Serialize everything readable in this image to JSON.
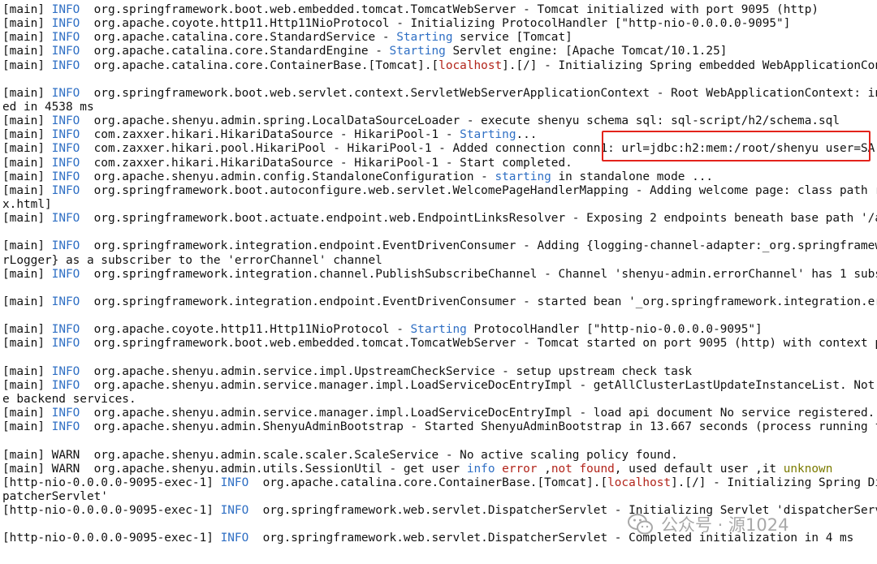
{
  "colors": {
    "default": "#111111",
    "info": "#2f6fc4",
    "blue": "#2f6fc4",
    "red": "#b2241a",
    "olive": "#7b7b00",
    "highlight_border": "#e3231b"
  },
  "watermark": {
    "icon": "wechat-icon",
    "text": "公众号 · 源1024"
  },
  "lines": [
    [
      [
        "[main] ",
        ""
      ],
      [
        "INFO",
        "info"
      ],
      [
        "  org.springframework.boot.web.embedded.tomcat.TomcatWebServer - Tomcat initialized with port 9095 (http)",
        ""
      ]
    ],
    [
      [
        "[main] ",
        ""
      ],
      [
        "INFO",
        "info"
      ],
      [
        "  org.apache.coyote.http11.Http11NioProtocol - Initializing ProtocolHandler [\"http-nio-0.0.0.0-9095\"]",
        ""
      ]
    ],
    [
      [
        "[main] ",
        ""
      ],
      [
        "INFO",
        "info"
      ],
      [
        "  org.apache.catalina.core.StandardService - ",
        ""
      ],
      [
        "Starting",
        "blue"
      ],
      [
        " service [Tomcat]",
        ""
      ]
    ],
    [
      [
        "[main] ",
        ""
      ],
      [
        "INFO",
        "info"
      ],
      [
        "  org.apache.catalina.core.StandardEngine - ",
        ""
      ],
      [
        "Starting",
        "blue"
      ],
      [
        " Servlet engine: [Apache Tomcat/10.1.25]",
        ""
      ]
    ],
    [
      [
        "[main] ",
        ""
      ],
      [
        "INFO",
        "info"
      ],
      [
        "  org.apache.catalina.core.ContainerBase.[Tomcat].[",
        ""
      ],
      [
        "localhost",
        "red"
      ],
      [
        "].[/] - Initializing Spring embedded WebApplicationCon",
        ""
      ]
    ],
    [],
    [
      [
        "[main] ",
        ""
      ],
      [
        "INFO",
        "info"
      ],
      [
        "  org.springframework.boot.web.servlet.context.ServletWebServerApplicationContext - Root WebApplicationContext: in",
        ""
      ]
    ],
    [
      [
        "ed in 4538 ms",
        ""
      ]
    ],
    [
      [
        "[main] ",
        ""
      ],
      [
        "INFO",
        "info"
      ],
      [
        "  org.apache.shenyu.admin.spring.LocalDataSourceLoader - execute shenyu schema sql: sql-script/h2/schema.sql",
        ""
      ]
    ],
    [
      [
        "[main] ",
        ""
      ],
      [
        "INFO",
        "info"
      ],
      [
        "  com.zaxxer.hikari.HikariDataSource - HikariPool-1 - ",
        ""
      ],
      [
        "Starting",
        "blue"
      ],
      [
        "...",
        ""
      ]
    ],
    [
      [
        "[main] ",
        ""
      ],
      [
        "INFO",
        "info"
      ],
      [
        "  com.zaxxer.hikari.pool.HikariPool - HikariPool-1 - Added connection conn1: url=jdbc:h2:mem:/root/shenyu user=SA",
        ""
      ]
    ],
    [
      [
        "[main] ",
        ""
      ],
      [
        "INFO",
        "info"
      ],
      [
        "  com.zaxxer.hikari.HikariDataSource - HikariPool-1 - Start completed.",
        ""
      ]
    ],
    [
      [
        "[main] ",
        ""
      ],
      [
        "INFO",
        "info"
      ],
      [
        "  org.apache.shenyu.admin.config.StandaloneConfiguration - ",
        ""
      ],
      [
        "starting",
        "blue"
      ],
      [
        " in standalone mode ...",
        ""
      ]
    ],
    [
      [
        "[main] ",
        ""
      ],
      [
        "INFO",
        "info"
      ],
      [
        "  org.springframework.boot.autoconfigure.web.servlet.WelcomePageHandlerMapping - Adding welcome page: class path r",
        ""
      ]
    ],
    [
      [
        "x.html]",
        ""
      ]
    ],
    [
      [
        "[main] ",
        ""
      ],
      [
        "INFO",
        "info"
      ],
      [
        "  org.springframework.boot.actuate.endpoint.web.EndpointLinksResolver - Exposing 2 endpoints beneath base path '/a",
        ""
      ]
    ],
    [],
    [
      [
        "[main] ",
        ""
      ],
      [
        "INFO",
        "info"
      ],
      [
        "  org.springframework.integration.endpoint.EventDrivenConsumer - Adding {logging-channel-adapter:_org.springframew",
        ""
      ]
    ],
    [
      [
        "rLogger} as a subscriber to the 'errorChannel' channel",
        ""
      ]
    ],
    [
      [
        "[main] ",
        ""
      ],
      [
        "INFO",
        "info"
      ],
      [
        "  org.springframework.integration.channel.PublishSubscribeChannel - Channel 'shenyu-admin.errorChannel' has 1 subs",
        ""
      ]
    ],
    [],
    [
      [
        "[main] ",
        ""
      ],
      [
        "INFO",
        "info"
      ],
      [
        "  org.springframework.integration.endpoint.EventDrivenConsumer - started bean '_org.springframework.integration.er",
        ""
      ]
    ],
    [],
    [
      [
        "[main] ",
        ""
      ],
      [
        "INFO",
        "info"
      ],
      [
        "  org.apache.coyote.http11.Http11NioProtocol - ",
        ""
      ],
      [
        "Starting",
        "blue"
      ],
      [
        " ProtocolHandler [\"http-nio-0.0.0.0-9095\"]",
        ""
      ]
    ],
    [
      [
        "[main] ",
        ""
      ],
      [
        "INFO",
        "info"
      ],
      [
        "  org.springframework.boot.web.embedded.tomcat.TomcatWebServer - Tomcat started on port 9095 (http) with context p",
        ""
      ]
    ],
    [],
    [
      [
        "[main] ",
        ""
      ],
      [
        "INFO",
        "info"
      ],
      [
        "  org.apache.shenyu.admin.service.impl.UpstreamCheckService - setup upstream check task",
        ""
      ]
    ],
    [
      [
        "[main] ",
        ""
      ],
      [
        "INFO",
        "info"
      ],
      [
        "  org.apache.shenyu.admin.service.manager.impl.LoadServiceDocEntryImpl - getAllClusterLastUpdateInstanceList. Not",
        ""
      ]
    ],
    [
      [
        "e backend services.",
        ""
      ]
    ],
    [
      [
        "[main] ",
        ""
      ],
      [
        "INFO",
        "info"
      ],
      [
        "  org.apache.shenyu.admin.service.manager.impl.LoadServiceDocEntryImpl - load api document No service registered.",
        ""
      ]
    ],
    [
      [
        "[main] ",
        ""
      ],
      [
        "INFO",
        "info"
      ],
      [
        "  org.apache.shenyu.admin.ShenyuAdminBootstrap - Started ShenyuAdminBootstrap in 13.667 seconds (process running f",
        ""
      ]
    ],
    [],
    [
      [
        "[main] ",
        ""
      ],
      [
        "WARN",
        "warn"
      ],
      [
        "  org.apache.shenyu.admin.scale.scaler.ScaleService - No active scaling policy found.",
        ""
      ]
    ],
    [
      [
        "[main] ",
        ""
      ],
      [
        "WARN",
        "warn"
      ],
      [
        "  org.apache.shenyu.admin.utils.SessionUtil - get user ",
        ""
      ],
      [
        "info",
        "blue"
      ],
      [
        " ",
        ""
      ],
      [
        "error",
        "red"
      ],
      [
        " ,",
        ""
      ],
      [
        "not found",
        "red"
      ],
      [
        ", used default user ,it ",
        ""
      ],
      [
        "unknown",
        "olive"
      ]
    ],
    [
      [
        "[http-nio-0.0.0.0-9095-exec-1] ",
        ""
      ],
      [
        "INFO",
        "info"
      ],
      [
        "  org.apache.catalina.core.ContainerBase.[Tomcat].[",
        ""
      ],
      [
        "localhost",
        "red"
      ],
      [
        "].[/] - Initializing Spring Di",
        ""
      ]
    ],
    [
      [
        "patcherServlet'",
        ""
      ]
    ],
    [
      [
        "[http-nio-0.0.0.0-9095-exec-1] ",
        ""
      ],
      [
        "INFO",
        "info"
      ],
      [
        "  org.springframework.web.servlet.DispatcherServlet - Initializing Servlet 'dispatcherServ",
        ""
      ]
    ],
    [],
    [
      [
        "[http-nio-0.0.0.0-9095-exec-1] ",
        ""
      ],
      [
        "INFO",
        "info"
      ],
      [
        "  org.springframework.web.servlet.DispatcherServlet - Completed initialization in 4 ms",
        ""
      ]
    ]
  ]
}
